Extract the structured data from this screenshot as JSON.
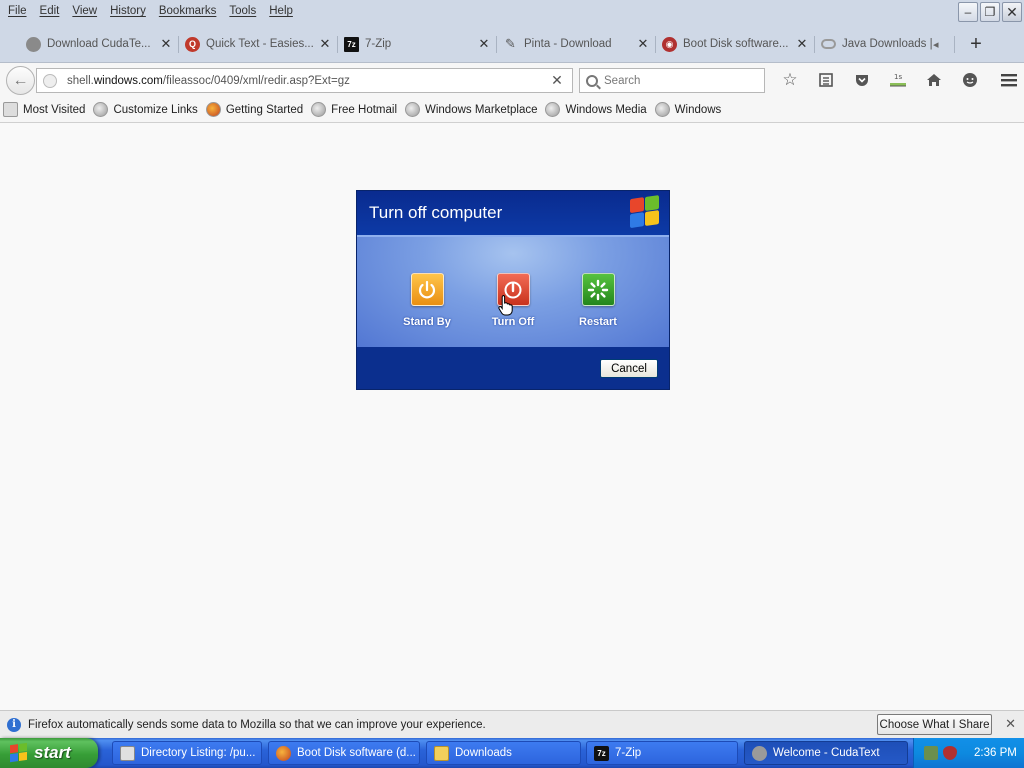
{
  "menu": [
    "File",
    "Edit",
    "View",
    "History",
    "Bookmarks",
    "Tools",
    "Help"
  ],
  "window_controls": {
    "minimize": "–",
    "restore": "❐",
    "close": "✕"
  },
  "tabs": [
    {
      "title": "Download CudaTe...",
      "icon": "cudatext-icon",
      "icon_color": "#8a8a8a"
    },
    {
      "title": "Quick Text - Easies...",
      "icon": "quicktext-icon",
      "icon_color": "#c0392b"
    },
    {
      "title": "7-Zip",
      "icon": "7zip-icon",
      "icon_color": "#111111"
    },
    {
      "title": "Pinta - Download",
      "icon": "pinta-icon",
      "icon_color": "#666666"
    },
    {
      "title": "Boot Disk software...",
      "icon": "bootdisk-icon",
      "icon_color": "#b03030"
    },
    {
      "title": "Java Downloads | ...",
      "icon": "java-icon",
      "icon_color": "#999999"
    }
  ],
  "tab_close": "✕",
  "new_tab": "+",
  "address": {
    "prefix": "shell.",
    "domain": "windows.com",
    "path": "/fileassoc/0409/xml/redir.asp?Ext=gz",
    "clear": "✕"
  },
  "search": {
    "placeholder": "Search"
  },
  "toolbar_icons": [
    "bookmark-star-icon",
    "reading-list-icon",
    "pocket-icon",
    "downloads-icon",
    "home-icon",
    "chat-icon",
    "menu-icon"
  ],
  "bookmarks": [
    "Most Visited",
    "Customize Links",
    "Getting Started",
    "Free Hotmail",
    "Windows Marketplace",
    "Windows Media",
    "Windows"
  ],
  "dialog": {
    "title": "Turn off computer",
    "options": [
      {
        "label": "Stand By",
        "color": "#f0a21e"
      },
      {
        "label": "Turn Off",
        "color": "#d9402b"
      },
      {
        "label": "Restart",
        "color": "#2f9b2f"
      }
    ],
    "cancel": "Cancel"
  },
  "notification": {
    "info": "i",
    "text": "Firefox automatically sends some data to Mozilla so that we can improve your experience.",
    "button": "Choose What I Share",
    "close": "✕"
  },
  "taskbar": {
    "start": "start",
    "tasks": [
      {
        "label": "Directory Listing: /pu...",
        "icon_color": "#e0e0e0"
      },
      {
        "label": "Boot Disk software (d...",
        "icon_color": "#e07b20"
      },
      {
        "label": "Downloads",
        "icon_color": "#f2cf5b"
      },
      {
        "label": "7-Zip",
        "icon_color": "#111111"
      },
      {
        "label": "Welcome - CudaText",
        "icon_color": "#9a9a9a"
      }
    ],
    "clock": "2:36 PM"
  }
}
